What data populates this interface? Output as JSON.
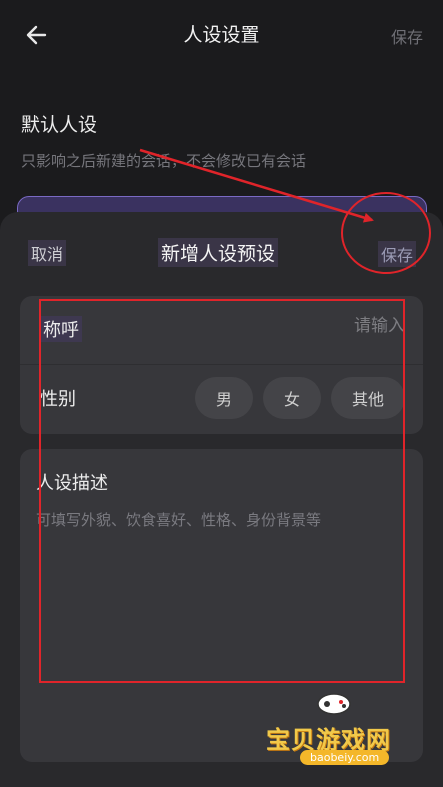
{
  "header": {
    "title": "人设设置",
    "save_label": "保存",
    "back_icon": "arrow-left-icon"
  },
  "default_section": {
    "title": "默认人设",
    "description": "只影响之后新建的会话，不会修改已有会话"
  },
  "sheet": {
    "cancel_label": "取消",
    "title": "新增人设预设",
    "save_label": "保存",
    "name_label": "称呼",
    "name_placeholder": "请输入",
    "gender_label": "性别",
    "gender_options": [
      "男",
      "女",
      "其他"
    ],
    "desc_label": "人设描述",
    "desc_placeholder": "可填写外貌、饮食喜好、性格、身份背景等"
  },
  "watermark": {
    "text": "宝贝游戏网",
    "url": "baobeiy.com"
  },
  "colors": {
    "background": "#1b1b1d",
    "sheet": "#29292c",
    "card": "#37373b",
    "annotation": "#e0242a",
    "accent_purple": "#7a6ac4"
  }
}
